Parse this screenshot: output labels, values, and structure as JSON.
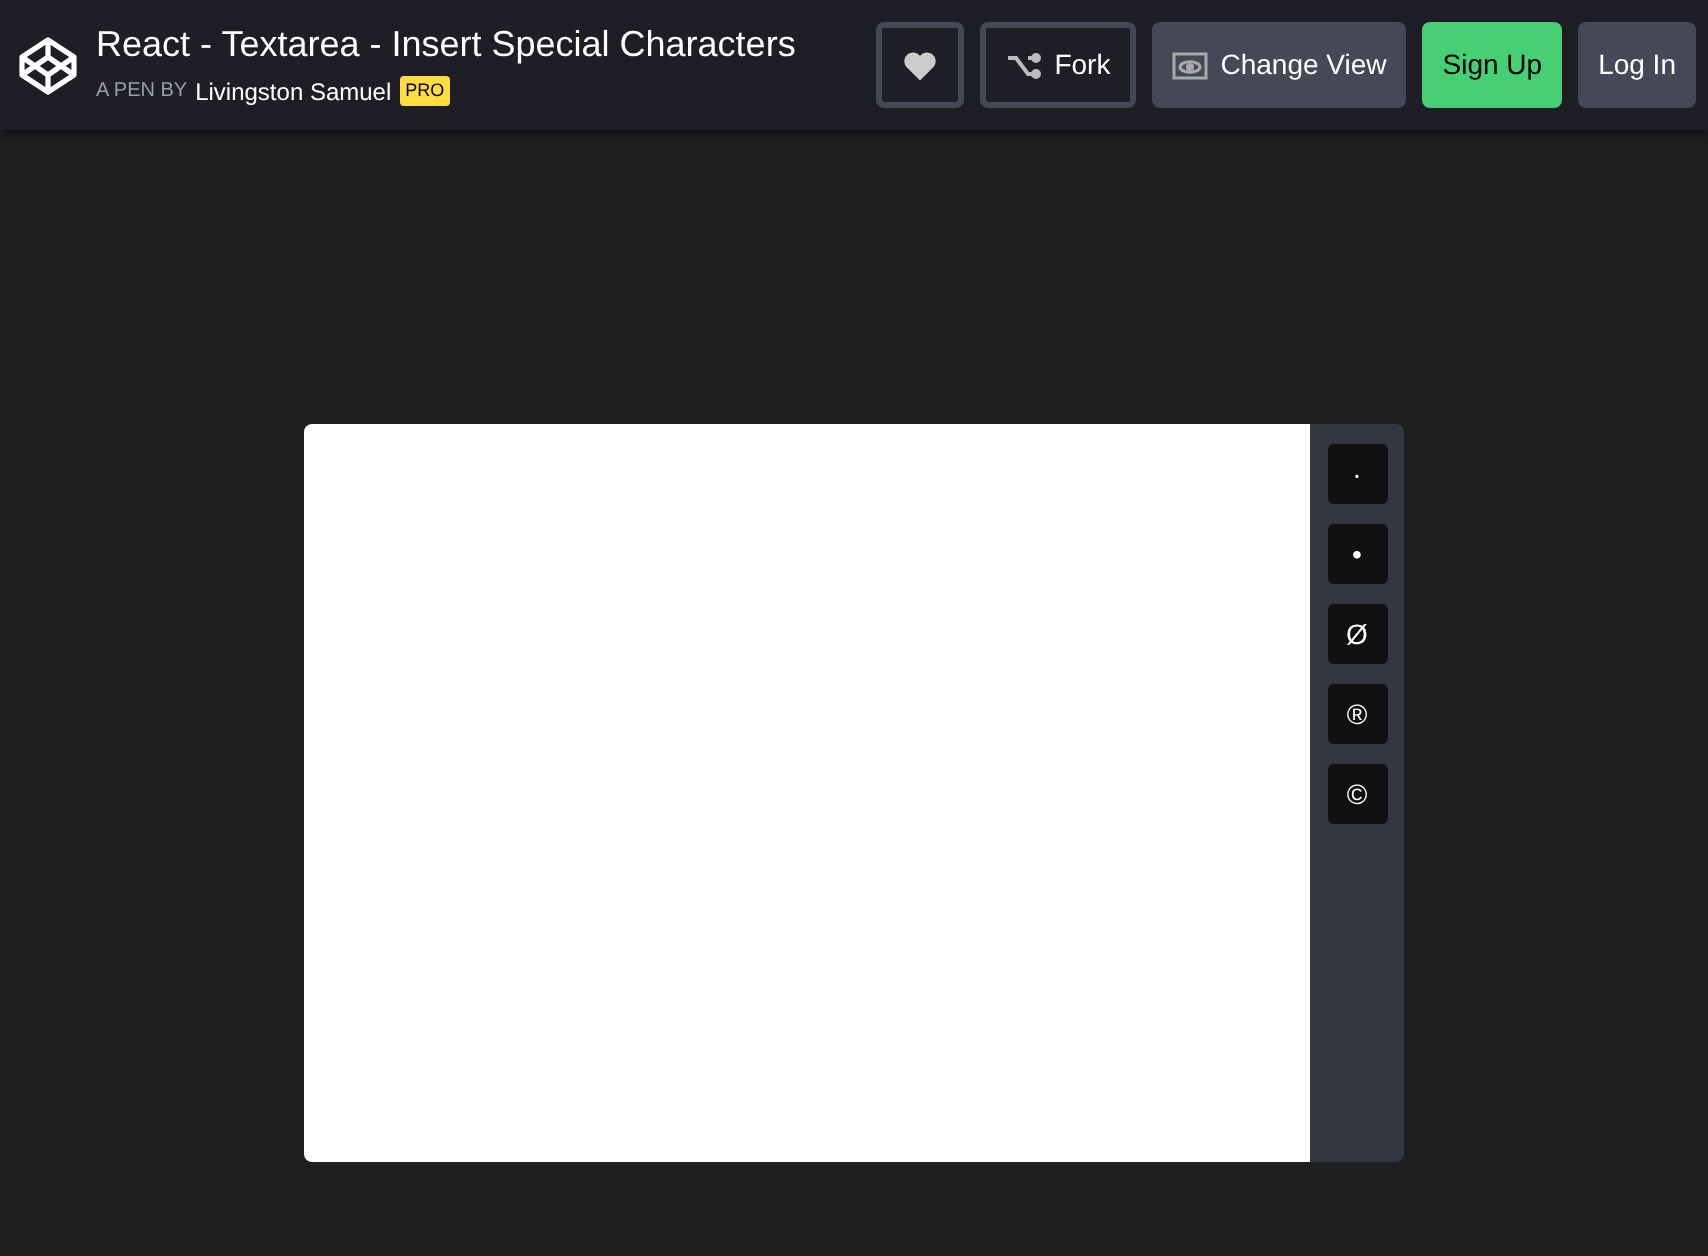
{
  "header": {
    "title": "React - Textarea - Insert Special Characters",
    "byline": "A PEN BY",
    "author": "Livingston Samuel",
    "badge": "PRO"
  },
  "actions": [
    {
      "kind": "heart"
    },
    {
      "kind": "fork",
      "label": "Fork"
    },
    {
      "kind": "view",
      "label": "Change View"
    },
    {
      "kind": "signup",
      "label": "Sign Up"
    },
    {
      "kind": "login",
      "label": "Log In"
    }
  ],
  "characters": [
    {
      "label": "·"
    },
    {
      "label": "•"
    },
    {
      "label": "Ø"
    },
    {
      "label": "®"
    },
    {
      "label": "©"
    }
  ]
}
